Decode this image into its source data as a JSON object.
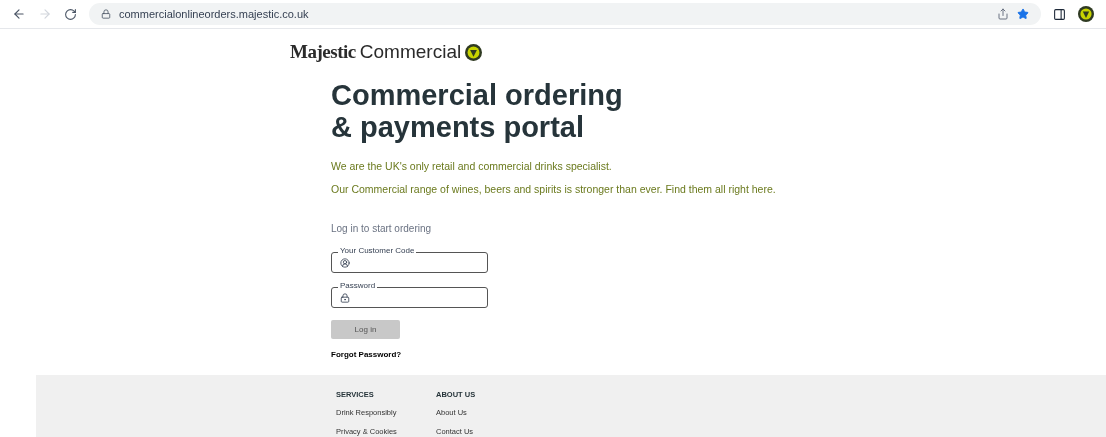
{
  "browser": {
    "url": "commercialonlineorders.majestic.co.uk"
  },
  "logo": {
    "brand": "Majestic",
    "suffix": "Commercial"
  },
  "heading": [
    "Commercial ordering",
    "& payments portal"
  ],
  "intro": [
    "We are the UK's only retail and commercial drinks specialist.",
    "Our Commercial range of wines, beers and spirits is stronger than ever. Find them all right here."
  ],
  "login": {
    "prompt": "Log in to start ordering",
    "fields": [
      {
        "kind": "user",
        "label": "Your Customer Code"
      },
      {
        "kind": "lock",
        "label": "Password"
      }
    ],
    "button": {
      "label": "Log in",
      "disabled": true
    },
    "forgot": "Forgot Password?"
  },
  "footer": {
    "columns": [
      {
        "title": "SERVICES",
        "links": [
          "Drink Responsibly",
          "Privacy & Cookies"
        ]
      },
      {
        "title": "ABOUT US",
        "links": [
          "About Us",
          "Contact Us"
        ]
      }
    ]
  }
}
